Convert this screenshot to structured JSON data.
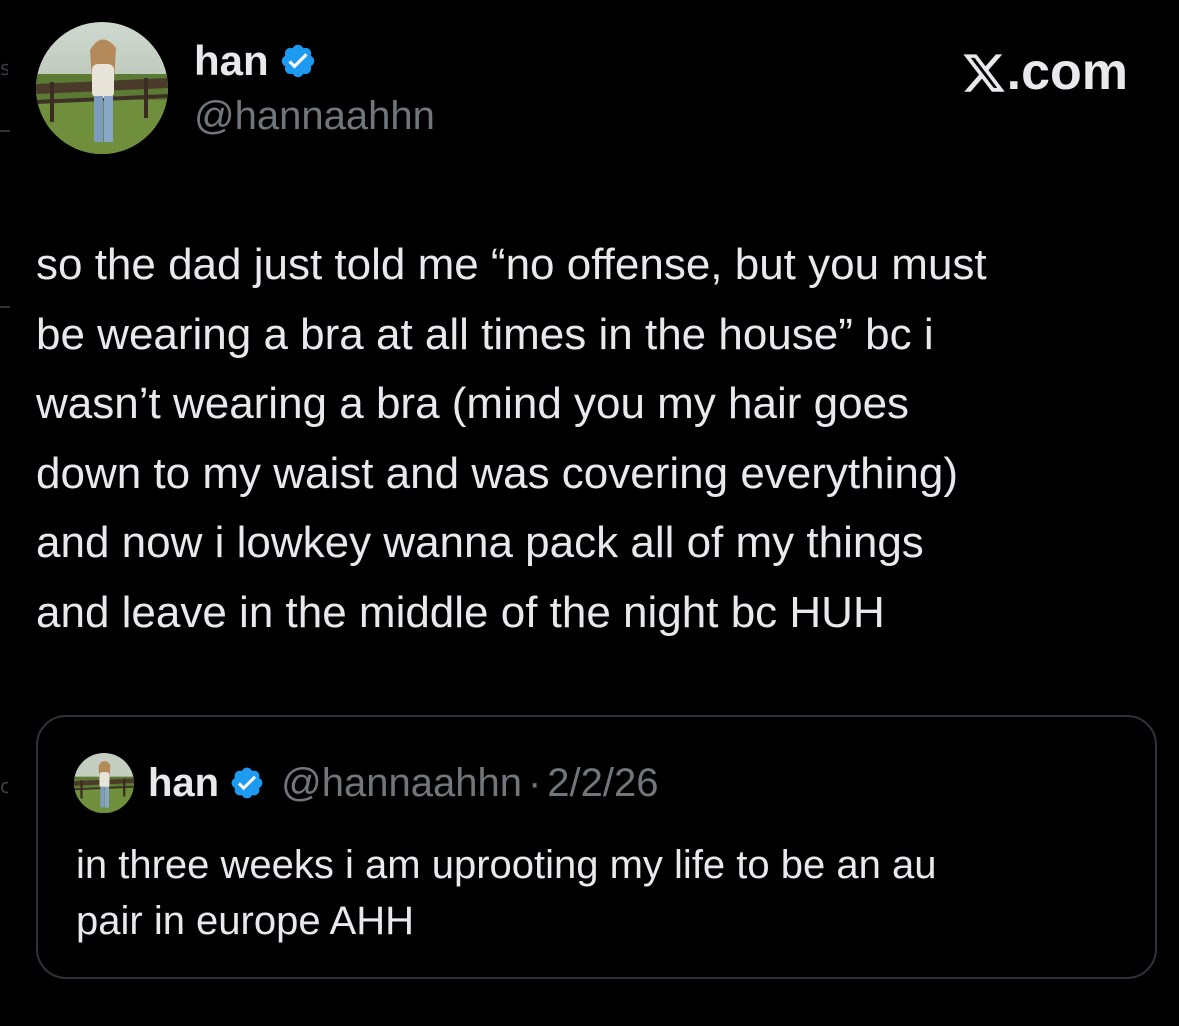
{
  "site": {
    "logo_text": ".com",
    "logo_icon": "x-logo-icon"
  },
  "tweet": {
    "author": {
      "display_name": "han",
      "handle": "@hannaahhn",
      "verified": true,
      "avatar": "profile-photo"
    },
    "text_lines": [
      "so the dad just told me “no offense, but you must",
      "be wearing a bra at all times in the house” bc i",
      "wasn’t wearing a bra (mind you my hair goes",
      "down to my waist and was covering everything)",
      "and now i lowkey wanna pack all of my things",
      "and leave in the middle of the night bc HUH"
    ]
  },
  "quoted_tweet": {
    "author": {
      "display_name": "han",
      "handle": "@hannaahhn",
      "verified": true
    },
    "separator": "·",
    "date": "2/2/26",
    "text_lines": [
      "in three weeks i am uprooting my life to be an au",
      "pair in europe AHH"
    ]
  },
  "colors": {
    "background": "#000000",
    "text_primary": "#e7e9ea",
    "text_secondary": "#71767b",
    "border": "#2f3336",
    "verified_blue": "#1d9bf0"
  }
}
